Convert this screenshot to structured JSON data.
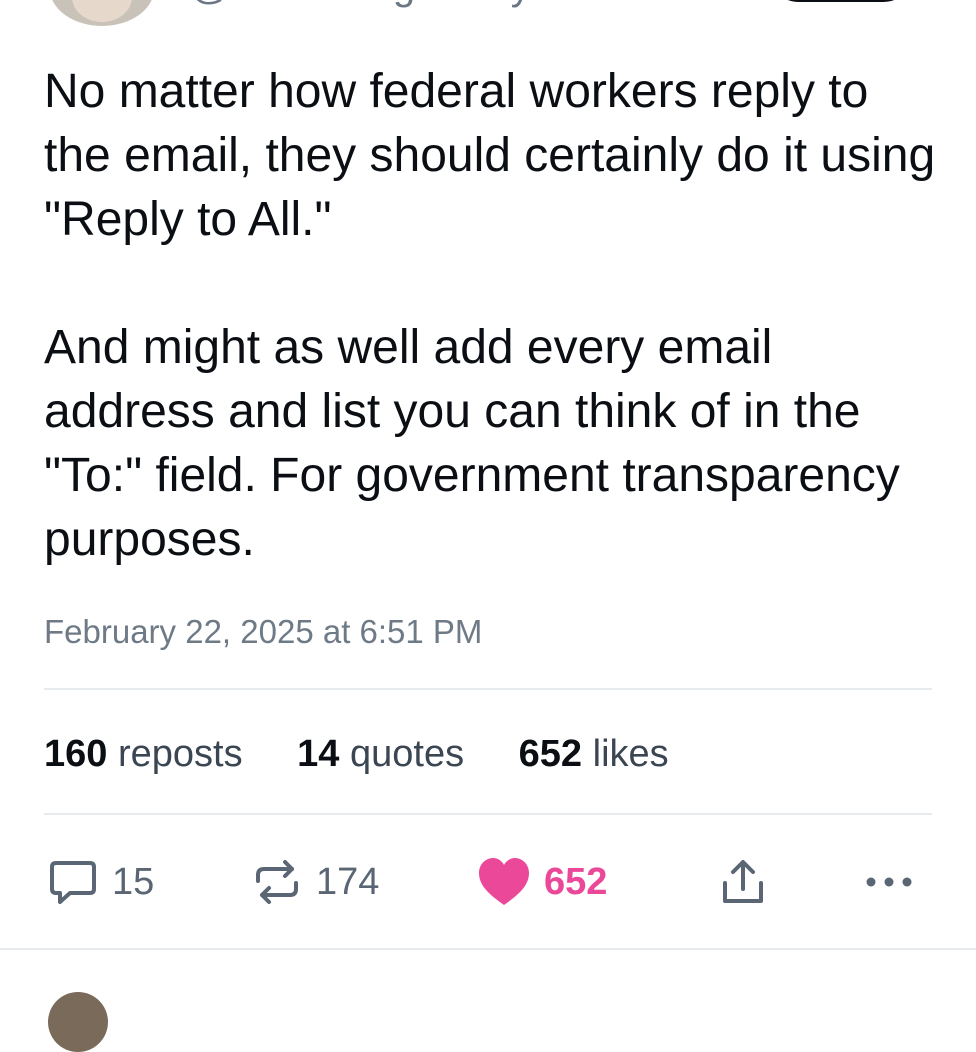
{
  "author": {
    "handle": "@dweldredge.bsky.social"
  },
  "post": {
    "paragraphs": [
      "No matter how federal workers reply to the email, they should certainly do it using \"Reply to All.\"",
      "And might as well add every email address and list you can think of in the \"To:\" field. For government transparency purposes."
    ],
    "timestamp": "February 22, 2025 at 6:51 PM"
  },
  "stats": {
    "reposts": {
      "count": "160",
      "label": "reposts"
    },
    "quotes": {
      "count": "14",
      "label": "quotes"
    },
    "likes": {
      "count": "652",
      "label": "likes"
    }
  },
  "actions": {
    "reply": {
      "icon": "reply-icon",
      "count": "15"
    },
    "repost": {
      "icon": "repost-icon",
      "count": "174"
    },
    "like": {
      "icon": "heart-icon",
      "count": "652",
      "liked": true,
      "color": "#ec4899"
    },
    "share": {
      "icon": "share-icon"
    },
    "more": {
      "icon": "more-icon"
    }
  }
}
